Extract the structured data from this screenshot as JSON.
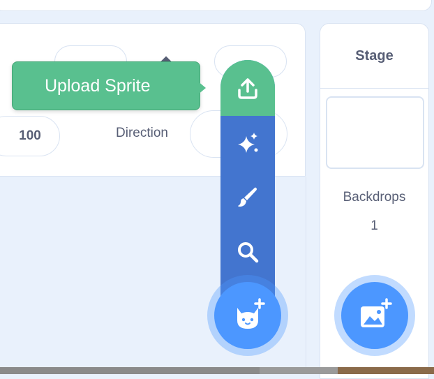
{
  "sprite_info": {
    "size_value": "100",
    "direction_label": "Direction"
  },
  "tooltip": {
    "label": "Upload Sprite"
  },
  "sprite_menu": {
    "items": [
      {
        "name": "upload",
        "icon": "upload-icon"
      },
      {
        "name": "surprise",
        "icon": "sparkle-icon"
      },
      {
        "name": "paint",
        "icon": "paintbrush-icon"
      },
      {
        "name": "choose",
        "icon": "search-icon"
      }
    ],
    "main_icon": "cat-plus-icon"
  },
  "stage": {
    "title": "Stage",
    "backdrops_label": "Backdrops",
    "backdrops_count": "1",
    "add_backdrop_icon": "image-plus-icon"
  },
  "colors": {
    "green": "#59c08f",
    "blue": "#4c97ff",
    "menu_blue": "#4375cf",
    "text": "#575e75"
  }
}
